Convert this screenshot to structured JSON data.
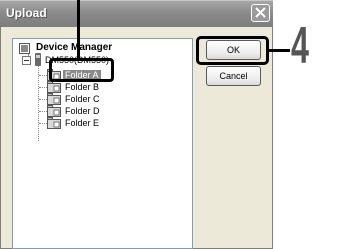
{
  "dialog": {
    "title": "Upload",
    "close_icon": "close-icon"
  },
  "tree": {
    "root_label": "Device Manager",
    "device_label": "DM550(DM550)",
    "folders": [
      "Folder A",
      "Folder B",
      "Folder C",
      "Folder D",
      "Folder E"
    ],
    "selected_folder": "Folder A"
  },
  "buttons": {
    "ok_label": "OK",
    "cancel_label": "Cancel"
  },
  "callout": {
    "step_number": "4"
  }
}
